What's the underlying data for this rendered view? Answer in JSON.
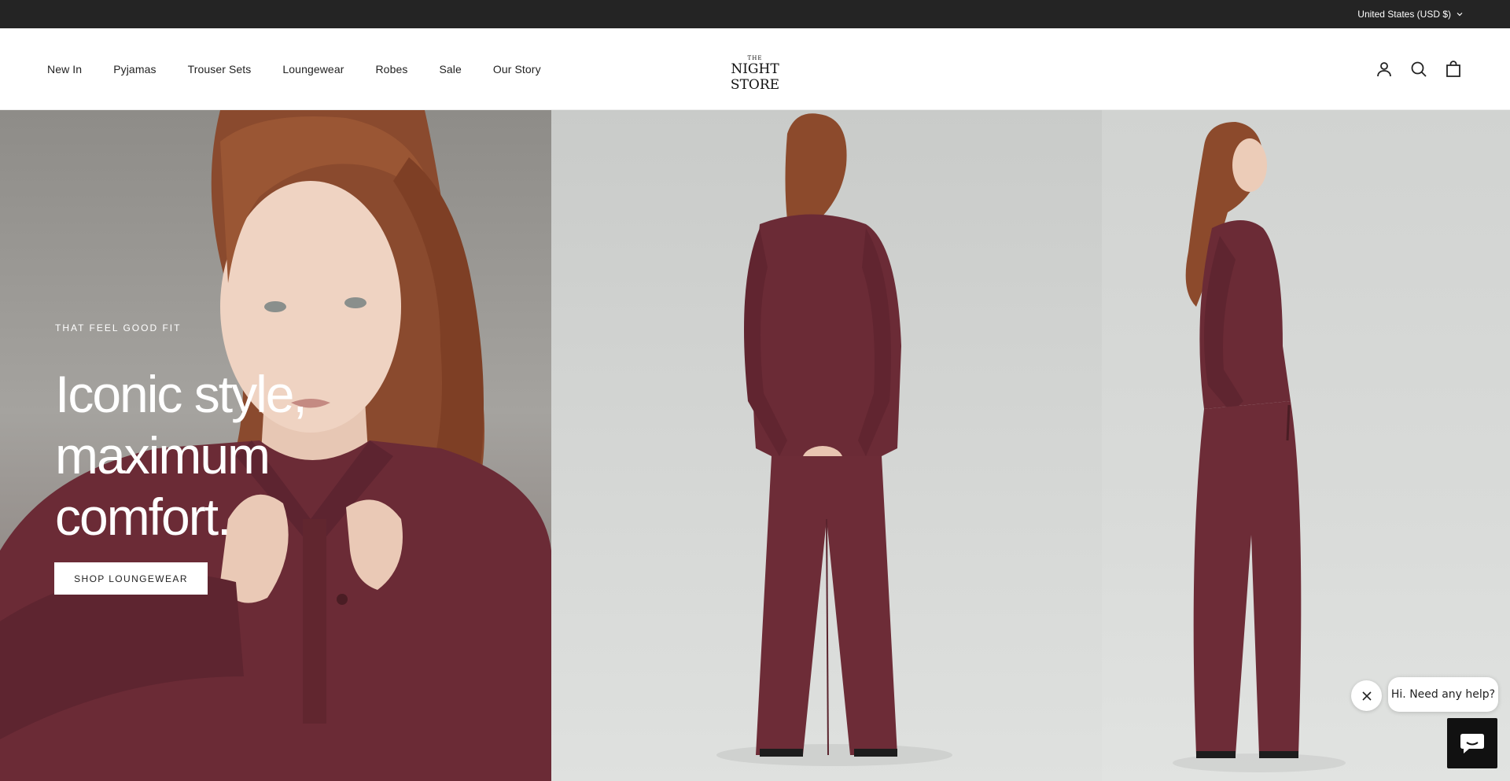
{
  "topbar": {
    "currency_label": "United States (USD $)",
    "icon": "chevron-down-icon"
  },
  "header": {
    "nav": [
      "New In",
      "Pyjamas",
      "Trouser Sets",
      "Loungewear",
      "Robes",
      "Sale",
      "Our Story"
    ],
    "logo": {
      "prefix": "THE",
      "name": "NIGHT STORE"
    },
    "icons": [
      "account-icon",
      "search-icon",
      "cart-icon"
    ]
  },
  "hero": {
    "eyebrow": "THAT FEEL GOOD FIT",
    "headline": "Iconic style, maximum comfort.",
    "cta_label": "SHOP LOUNGEWEAR",
    "accent_color": "#6b2b36"
  },
  "chat": {
    "greeting": "Hi. Need any help?",
    "close_icon": "close-icon",
    "launcher_icon": "chat-icon"
  }
}
